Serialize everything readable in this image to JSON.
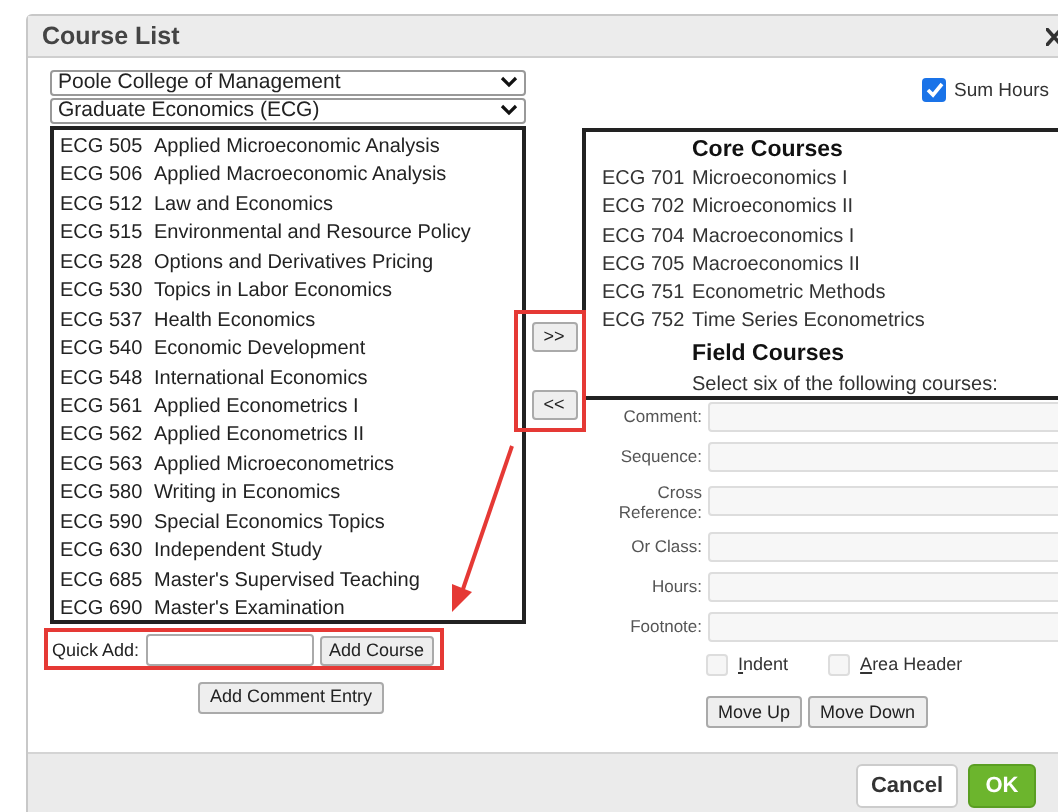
{
  "window": {
    "title": "Course List"
  },
  "department_select": {
    "value": "Poole College of Management"
  },
  "program_select": {
    "value": "Graduate Economics (ECG)"
  },
  "available_courses": [
    {
      "code": "ECG 505",
      "title": "Applied Microeconomic Analysis"
    },
    {
      "code": "ECG 506",
      "title": "Applied Macroeconomic Analysis"
    },
    {
      "code": "ECG 512",
      "title": "Law and Economics"
    },
    {
      "code": "ECG 515",
      "title": "Environmental and Resource Policy"
    },
    {
      "code": "ECG 528",
      "title": "Options and Derivatives Pricing"
    },
    {
      "code": "ECG 530",
      "title": "Topics in Labor Economics"
    },
    {
      "code": "ECG 537",
      "title": "Health Economics"
    },
    {
      "code": "ECG 540",
      "title": "Economic Development"
    },
    {
      "code": "ECG 548",
      "title": "International Economics"
    },
    {
      "code": "ECG 561",
      "title": "Applied Econometrics I"
    },
    {
      "code": "ECG 562",
      "title": "Applied Econometrics II"
    },
    {
      "code": "ECG 563",
      "title": "Applied Microeconometrics"
    },
    {
      "code": "ECG 580",
      "title": "Writing in Economics"
    },
    {
      "code": "ECG 590",
      "title": "Special Economics Topics"
    },
    {
      "code": "ECG 630",
      "title": "Independent Study"
    },
    {
      "code": "ECG 685",
      "title": "Master's Supervised Teaching"
    },
    {
      "code": "ECG 690",
      "title": "Master's Examination"
    }
  ],
  "transfer_buttons": [
    ">>",
    "<<"
  ],
  "sum_hours": {
    "label": "Sum Hours",
    "checked": true
  },
  "selected_list": [
    {
      "kind": "heading",
      "text": "Core Courses"
    },
    {
      "kind": "course",
      "code": "ECG 701",
      "title": "Microeconomics I"
    },
    {
      "kind": "course",
      "code": "ECG 702",
      "title": "Microeconomics II"
    },
    {
      "kind": "course",
      "code": "ECG 704",
      "title": "Macroeconomics I"
    },
    {
      "kind": "course",
      "code": "ECG 705",
      "title": "Macroeconomics II"
    },
    {
      "kind": "course",
      "code": "ECG 751",
      "title": "Econometric Methods"
    },
    {
      "kind": "course",
      "code": "ECG 752",
      "title": "Time Series Econometrics"
    },
    {
      "kind": "heading",
      "text": "Field Courses"
    },
    {
      "kind": "note",
      "text": "Select six of the following courses:"
    }
  ],
  "form_fields": [
    {
      "label": "Comment:"
    },
    {
      "label": "Sequence:"
    },
    {
      "label": "Cross Reference:"
    },
    {
      "label": "Or Class:"
    },
    {
      "label": "Hours:"
    },
    {
      "label": "Footnote:"
    }
  ],
  "options": [
    {
      "label": "Indent",
      "checked": false
    },
    {
      "label": "Area Header",
      "checked": false
    }
  ],
  "quick_add": {
    "label": "Quick Add:",
    "button": "Add Course"
  },
  "add_comment_button": "Add Comment Entry",
  "move_buttons": [
    "Move Up",
    "Move Down"
  ],
  "footer_buttons": [
    {
      "label": "Cancel",
      "kind": "secondary"
    },
    {
      "label": "OK",
      "kind": "primary"
    }
  ]
}
